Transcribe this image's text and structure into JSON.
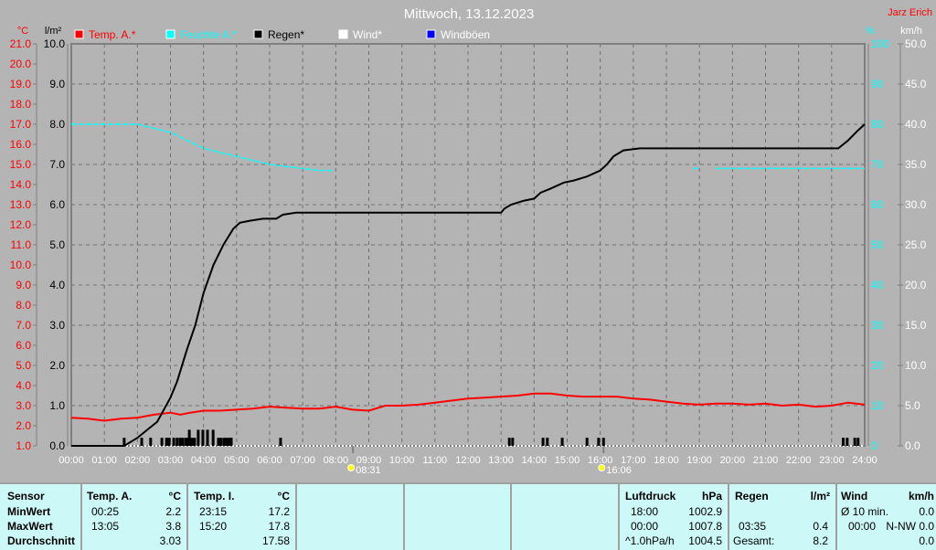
{
  "header": {
    "title": "Mittwoch, 13.12.2023",
    "author": "Jarz Erich"
  },
  "colors": {
    "temp": "#ff0000",
    "humidity": "#00ffff",
    "rain": "#000000",
    "wind": "#ffffff",
    "gust": "#0000ff",
    "grid": "#707070"
  },
  "chart_data": {
    "type": "line",
    "legend": [
      {
        "name": "Temp. A.*",
        "color": "#ff0000"
      },
      {
        "name": "Feuchte A.*",
        "color": "#00ffff"
      },
      {
        "name": "Regen*",
        "color": "#000000"
      },
      {
        "name": "Wind*",
        "color": "#ffffff"
      },
      {
        "name": "Windböen",
        "color": "#0000ff"
      }
    ],
    "legend_placement": "top",
    "grid": true,
    "x_ticks": [
      "00:00",
      "01:00",
      "02:00",
      "03:00",
      "04:00",
      "05:00",
      "06:00",
      "07:00",
      "08:00",
      "09:00",
      "10:00",
      "11:00",
      "12:00",
      "13:00",
      "14:00",
      "15:00",
      "16:00",
      "17:00",
      "18:00",
      "19:00",
      "20:00",
      "21:00",
      "22:00",
      "23:00",
      "24:00"
    ],
    "xlim": [
      0,
      24
    ],
    "axes": {
      "temp": {
        "unit": "°C",
        "ylim": [
          1,
          21
        ],
        "ticks": [
          "21.0",
          "20.0",
          "19.0",
          "18.0",
          "17.0",
          "16.0",
          "15.0",
          "14.0",
          "13.0",
          "12.0",
          "11.0",
          "10.0",
          "9.0",
          "8.0",
          "7.0",
          "6.0",
          "5.0",
          "4.0",
          "3.0",
          "2.0",
          "1.0"
        ]
      },
      "rain": {
        "unit": "l/m²",
        "ylim": [
          0,
          10
        ],
        "ticks": [
          "10.0",
          "9.0",
          "8.0",
          "7.0",
          "6.0",
          "5.0",
          "4.0",
          "3.0",
          "2.0",
          "1.0",
          "0.0"
        ]
      },
      "humidity": {
        "unit": "%",
        "ylim": [
          0,
          100
        ],
        "ticks": [
          "100",
          "90",
          "80",
          "70",
          "60",
          "50",
          "40",
          "30",
          "20",
          "10",
          "0"
        ]
      },
      "wind": {
        "unit": "km/h",
        "ylim": [
          0,
          50
        ],
        "ticks": [
          "50.0",
          "45.0",
          "40.0",
          "35.0",
          "30.0",
          "25.0",
          "20.0",
          "15.0",
          "10.0",
          "5.0",
          "0.0"
        ]
      }
    },
    "series": [
      {
        "name": "Temp. A.*",
        "axis": "temp",
        "x": [
          0,
          0.5,
          1,
          1.5,
          2,
          2.5,
          3,
          3.3,
          3.6,
          4,
          4.5,
          5,
          5.5,
          6,
          6.5,
          7,
          7.5,
          8,
          8.5,
          9,
          9.5,
          10,
          10.5,
          11,
          11.5,
          12,
          12.5,
          13,
          13.5,
          14,
          14.5,
          15,
          15.5,
          16,
          16.5,
          17,
          17.5,
          18,
          18.5,
          19,
          19.5,
          20,
          20.5,
          21,
          21.5,
          22,
          22.5,
          23,
          23.5,
          24
        ],
        "y": [
          2.4,
          2.35,
          2.25,
          2.35,
          2.4,
          2.55,
          2.65,
          2.55,
          2.65,
          2.75,
          2.75,
          2.8,
          2.85,
          2.95,
          2.9,
          2.85,
          2.85,
          2.95,
          2.8,
          2.75,
          3.0,
          3.0,
          3.05,
          3.15,
          3.25,
          3.35,
          3.4,
          3.45,
          3.5,
          3.6,
          3.6,
          3.5,
          3.45,
          3.45,
          3.45,
          3.35,
          3.3,
          3.2,
          3.1,
          3.05,
          3.1,
          3.1,
          3.05,
          3.1,
          3.0,
          3.05,
          2.95,
          3.0,
          3.15,
          3.05
        ]
      },
      {
        "name": "Feuchte A.*",
        "axis": "humidity",
        "segments": [
          {
            "x": [
              0,
              1,
              2,
              2.5,
              3,
              3.5,
              4,
              4.5,
              5,
              5.5,
              6,
              6.5,
              7,
              7.5,
              7.9
            ],
            "y": [
              80,
              80,
              80,
              79,
              78,
              76,
              74,
              73,
              72,
              71,
              70,
              69.5,
              69,
              68.5,
              68.5
            ]
          },
          {
            "x": [
              18.8,
              19.0
            ],
            "y": [
              69,
              69
            ]
          },
          {
            "x": [
              19.5,
              24
            ],
            "y": [
              69,
              69
            ]
          }
        ]
      },
      {
        "name": "Regen*",
        "axis": "rain",
        "x": [
          0,
          1.6,
          1.8,
          2.0,
          2.3,
          2.6,
          2.8,
          3.0,
          3.2,
          3.5,
          3.75,
          4.0,
          4.3,
          4.6,
          4.9,
          5.1,
          5.4,
          5.8,
          6.2,
          6.4,
          6.8,
          7.2,
          13.0,
          13.1,
          13.3,
          13.7,
          14.0,
          14.2,
          14.5,
          14.9,
          15.2,
          15.6,
          16.0,
          16.2,
          16.4,
          16.7,
          17.2,
          23.2,
          23.5,
          23.8,
          24
        ],
        "y": [
          0,
          0,
          0.1,
          0.2,
          0.4,
          0.6,
          0.9,
          1.2,
          1.6,
          2.4,
          3.0,
          3.8,
          4.5,
          5.0,
          5.4,
          5.55,
          5.6,
          5.65,
          5.65,
          5.75,
          5.8,
          5.8,
          5.8,
          5.9,
          6.0,
          6.1,
          6.15,
          6.3,
          6.4,
          6.55,
          6.6,
          6.7,
          6.85,
          7.0,
          7.2,
          7.35,
          7.4,
          7.4,
          7.6,
          7.85,
          8.0
        ]
      },
      {
        "name": "rain-bars",
        "axis": "rain",
        "type": "bar",
        "x": [
          1.6,
          2.13,
          2.4,
          2.74,
          2.88,
          2.96,
          3.1,
          3.2,
          3.29,
          3.37,
          3.46,
          3.51,
          3.57,
          3.65,
          3.73,
          3.84,
          3.98,
          4.12,
          4.29,
          4.45,
          4.53,
          4.62,
          4.7,
          4.78,
          4.84,
          6.33,
          13.25,
          13.35,
          14.27,
          14.4,
          14.85,
          15.6,
          15.95,
          16.1,
          23.35,
          23.47,
          23.7,
          23.8
        ],
        "y": [
          0.2,
          0.2,
          0.2,
          0.2,
          0.2,
          0.2,
          0.2,
          0.2,
          0.2,
          0.2,
          0.2,
          0.2,
          0.4,
          0.2,
          0.2,
          0.4,
          0.4,
          0.4,
          0.4,
          0.2,
          0.2,
          0.2,
          0.2,
          0.2,
          0.2,
          0.2,
          0.2,
          0.2,
          0.2,
          0.2,
          0.2,
          0.2,
          0.2,
          0.2,
          0.2,
          0.2,
          0.2,
          0.2
        ]
      }
    ],
    "annotations": [
      {
        "label": "08:31",
        "icon": "sunrise-icon",
        "x": 8.52
      },
      {
        "label": "16:06",
        "icon": "sunset-icon",
        "x": 16.1
      }
    ]
  },
  "table": {
    "temp_a": {
      "h": [
        "Sensor",
        "Temp. A.",
        "°C"
      ],
      "rows": [
        [
          "MinWert",
          "00:25",
          "2.2"
        ],
        [
          "MaxWert",
          "13:05",
          "3.8"
        ],
        [
          "Durchschnitt",
          "",
          "3.03"
        ]
      ]
    },
    "temp_i": {
      "h": [
        "Temp. I.",
        "°C"
      ],
      "rows": [
        [
          "23:15",
          "17.2"
        ],
        [
          "15:20",
          "17.8"
        ],
        [
          "",
          "17.58"
        ]
      ]
    },
    "pressure": {
      "h": [
        "Luftdruck",
        "hPa"
      ],
      "rows": [
        [
          "18:00",
          "1002.9"
        ],
        [
          "00:00",
          "1007.8"
        ],
        [
          "^1.0hPa/h",
          "1004.5"
        ]
      ]
    },
    "rain": {
      "h": [
        "Regen",
        "l/m²"
      ],
      "rows": [
        [
          "",
          ""
        ],
        [
          "03:35",
          "0.4"
        ],
        [
          "Gesamt:",
          "8.2"
        ]
      ]
    },
    "wind": {
      "h": [
        "Wind",
        "km/h"
      ],
      "rows": [
        [
          "Ø 10 min.",
          "0.0"
        ],
        [
          "00:00",
          "N-NW 0.0"
        ],
        [
          "",
          "0.0"
        ]
      ]
    }
  }
}
